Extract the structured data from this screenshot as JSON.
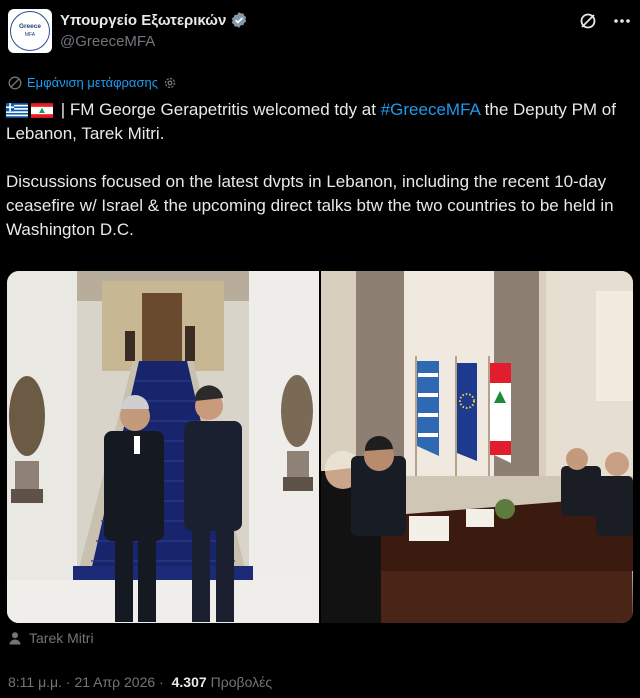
{
  "account": {
    "display_name": "Υπουργείο Εξωτερικών",
    "handle": "@GreeceMFA",
    "avatar_text": "Greece",
    "avatar_subtext": "MFA",
    "verified_color": "#829aab"
  },
  "header_icons": [
    "grok-icon",
    "more-icon"
  ],
  "translate_label": "Εμφάνιση μετάφρασης",
  "tweet": {
    "flags": [
      "greece-flag",
      "lebanon-flag"
    ],
    "line1_prefix": " | FM George Gerapetritis welcomed tdy at ",
    "hashtag": "#GreeceMFA",
    "line1_suffix": " the Deputy PM of Lebanon, Tarek Mitri.",
    "paragraph2": "Discussions focused on the latest dvpts in Lebanon, including the recent 10-day ceasefire w/ Israel & the upcoming direct talks btw the two countries to be held in Washington D.C."
  },
  "tagged_user": "Tarek Mitri",
  "meta": {
    "time": "8:11 μ.μ.",
    "separator": " · ",
    "date": "21 Απρ 2026",
    "views_sep": " · ",
    "views": "4.307",
    "views_label": "Προβολές"
  },
  "colors": {
    "background": "#000000",
    "text": "#e7e9ea",
    "muted": "#71767b",
    "link": "#1d9bf0"
  }
}
